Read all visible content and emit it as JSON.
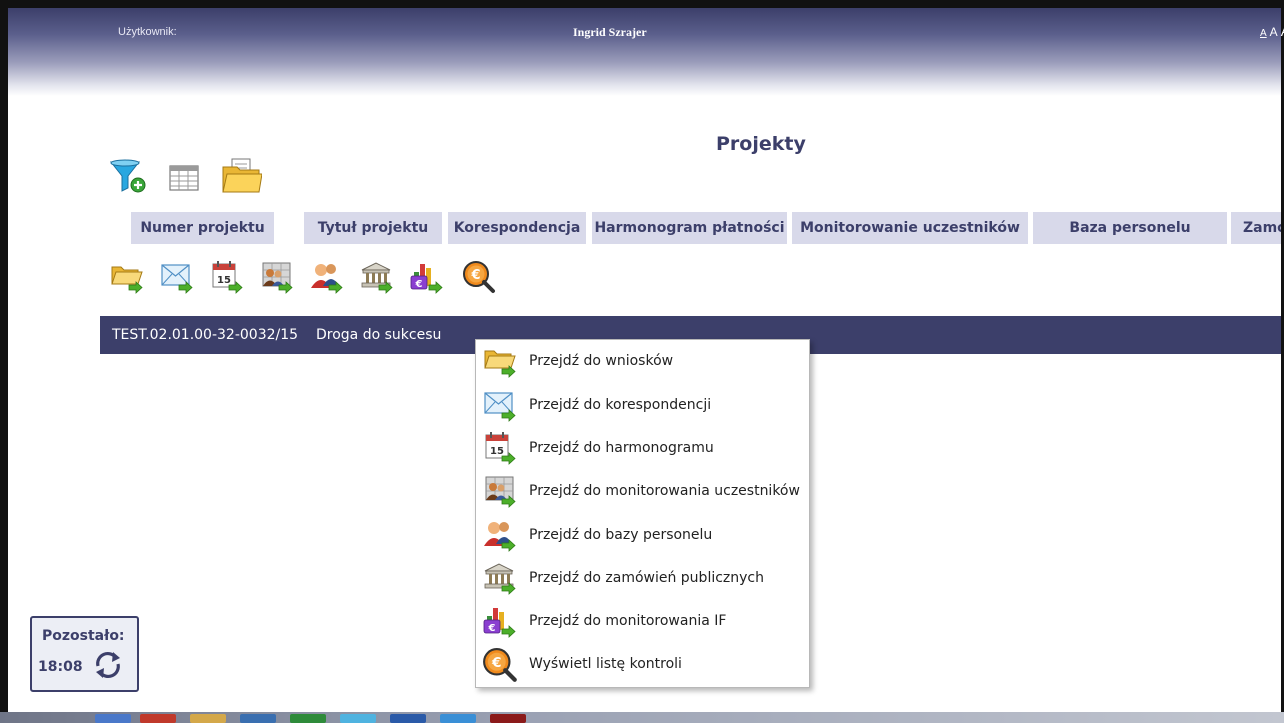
{
  "header": {
    "user_label": "Użytkownik:",
    "user_name": "Ingrid Szrajer",
    "font_size_small": "A",
    "font_size_medium": "A",
    "font_size_large": "A"
  },
  "page": {
    "title": "Projekty"
  },
  "toolbar": {
    "icons": [
      "filter-add-icon",
      "table-icon",
      "folder-documents-icon"
    ]
  },
  "columns": [
    "Numer projektu",
    "Tytuł projektu",
    "Korespondencja",
    "Harmonogram płatności",
    "Monitorowanie uczestników",
    "Baza personelu",
    "Zamó"
  ],
  "actions": {
    "icons": [
      "folder-arrow-icon",
      "envelope-arrow-icon",
      "calendar-arrow-icon",
      "participants-arrow-icon",
      "people-arrow-icon",
      "bank-arrow-icon",
      "chart-euro-arrow-icon",
      "euro-magnifier-icon"
    ]
  },
  "project_row": {
    "number": "TEST.02.01.00-32-0032/15",
    "title": "Droga do sukcesu"
  },
  "context_menu": {
    "items": [
      {
        "label": "Przejdź do wniosków",
        "icon": "folder-arrow-icon"
      },
      {
        "label": "Przejdź do korespondencji",
        "icon": "envelope-arrow-icon"
      },
      {
        "label": "Przejdź do harmonogramu",
        "icon": "calendar-arrow-icon"
      },
      {
        "label": "Przejdź do monitorowania uczestników",
        "icon": "participants-arrow-icon"
      },
      {
        "label": "Przejdź do bazy personelu",
        "icon": "people-arrow-icon"
      },
      {
        "label": "Przejdź do zamówień publicznych",
        "icon": "bank-arrow-icon"
      },
      {
        "label": "Przejdź do monitorowania IF",
        "icon": "chart-euro-arrow-icon"
      },
      {
        "label": "Wyświetl listę kontroli",
        "icon": "euro-magnifier-icon"
      }
    ]
  },
  "timer": {
    "label": "Pozostało:",
    "value": "18:08",
    "icon": "refresh-icon"
  },
  "colors": {
    "brand": "#3c3f6a",
    "column_header_bg": "#d8d9ea",
    "green_arrow": "#4caf2a"
  }
}
